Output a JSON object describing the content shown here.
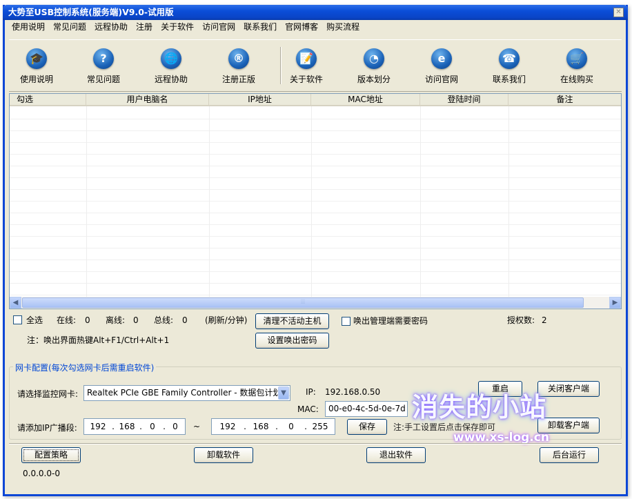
{
  "window": {
    "title": "大势至USB控制系统(服务端)V9.0-试用版",
    "close": "✕"
  },
  "menu": [
    "使用说明",
    "常见问题",
    "远程协助",
    "注册",
    "关于软件",
    "访问官网",
    "联系我们",
    "官网博客",
    "购买流程"
  ],
  "toolbar": [
    {
      "label": "使用说明",
      "icon": "graduation-cap-icon",
      "glyph": "🎓"
    },
    {
      "label": "常见问题",
      "icon": "question-icon",
      "glyph": "?"
    },
    {
      "label": "远程协助",
      "icon": "globe-icon",
      "glyph": "🌐"
    },
    {
      "label": "注册正版",
      "icon": "registered-icon",
      "glyph": "®"
    },
    {
      "label": "关于软件",
      "icon": "document-icon",
      "glyph": "📝"
    },
    {
      "label": "版本划分",
      "icon": "pie-chart-icon",
      "glyph": "◔"
    },
    {
      "label": "访问官网",
      "icon": "internet-explorer-icon",
      "glyph": "e"
    },
    {
      "label": "联系我们",
      "icon": "phone-icon",
      "glyph": "☎"
    },
    {
      "label": "在线购买",
      "icon": "cart-icon",
      "glyph": "🛒"
    }
  ],
  "table": {
    "columns": [
      "勾选",
      "用户电脑名",
      "IP地址",
      "MAC地址",
      "登陆时间",
      "备注"
    ],
    "scroll_left": "◀",
    "scroll_right": "▶",
    "thumb_grip": "⦙⦙⦙"
  },
  "status": {
    "select_all": "全选",
    "online_label": "在线:",
    "online": "0",
    "offline_label": "离线:",
    "offline": "0",
    "total_label": "总线:",
    "total": "0",
    "refresh": "(刷新/分钟)",
    "clear_inactive": "清理不活动主机",
    "require_password": "唤出管理端需要密码",
    "license_label": "授权数:",
    "license": "2",
    "hotkey_note": "注：唤出界面热键Alt+F1/Ctrl+Alt+1",
    "set_password": "设置唤出密码"
  },
  "nic": {
    "group_title": "网卡配置(每次勾选网卡后需重启软件)",
    "select_label": "请选择监控网卡:",
    "selected_nic": "Realtek PCIe GBE Family Controller - 数据包计划程序",
    "ip_label": "IP:",
    "ip": "192.168.0.50",
    "mac_label": "MAC:",
    "mac": "00-e0-4c-5d-0e-7d",
    "restart": "重启",
    "close_client": "关闭客户端",
    "uninstall_client": "卸载客户端",
    "broadcast_label": "请添加IP广播段:",
    "range_from": [
      "192",
      "168",
      "0",
      "0"
    ],
    "range_sep": "~",
    "range_to": [
      "192",
      "168",
      "0",
      "255"
    ],
    "save": "保存",
    "save_note": "注:手工设置后点击保存即可"
  },
  "footer": {
    "config_policy": "配置策略",
    "uninstall_software": "卸载软件",
    "exit_software": "退出软件",
    "background_run": "后台运行",
    "ip_status": "0.0.0.0-0"
  },
  "watermark": {
    "title": "消失的小站",
    "url": "www.xs-log.cn"
  }
}
